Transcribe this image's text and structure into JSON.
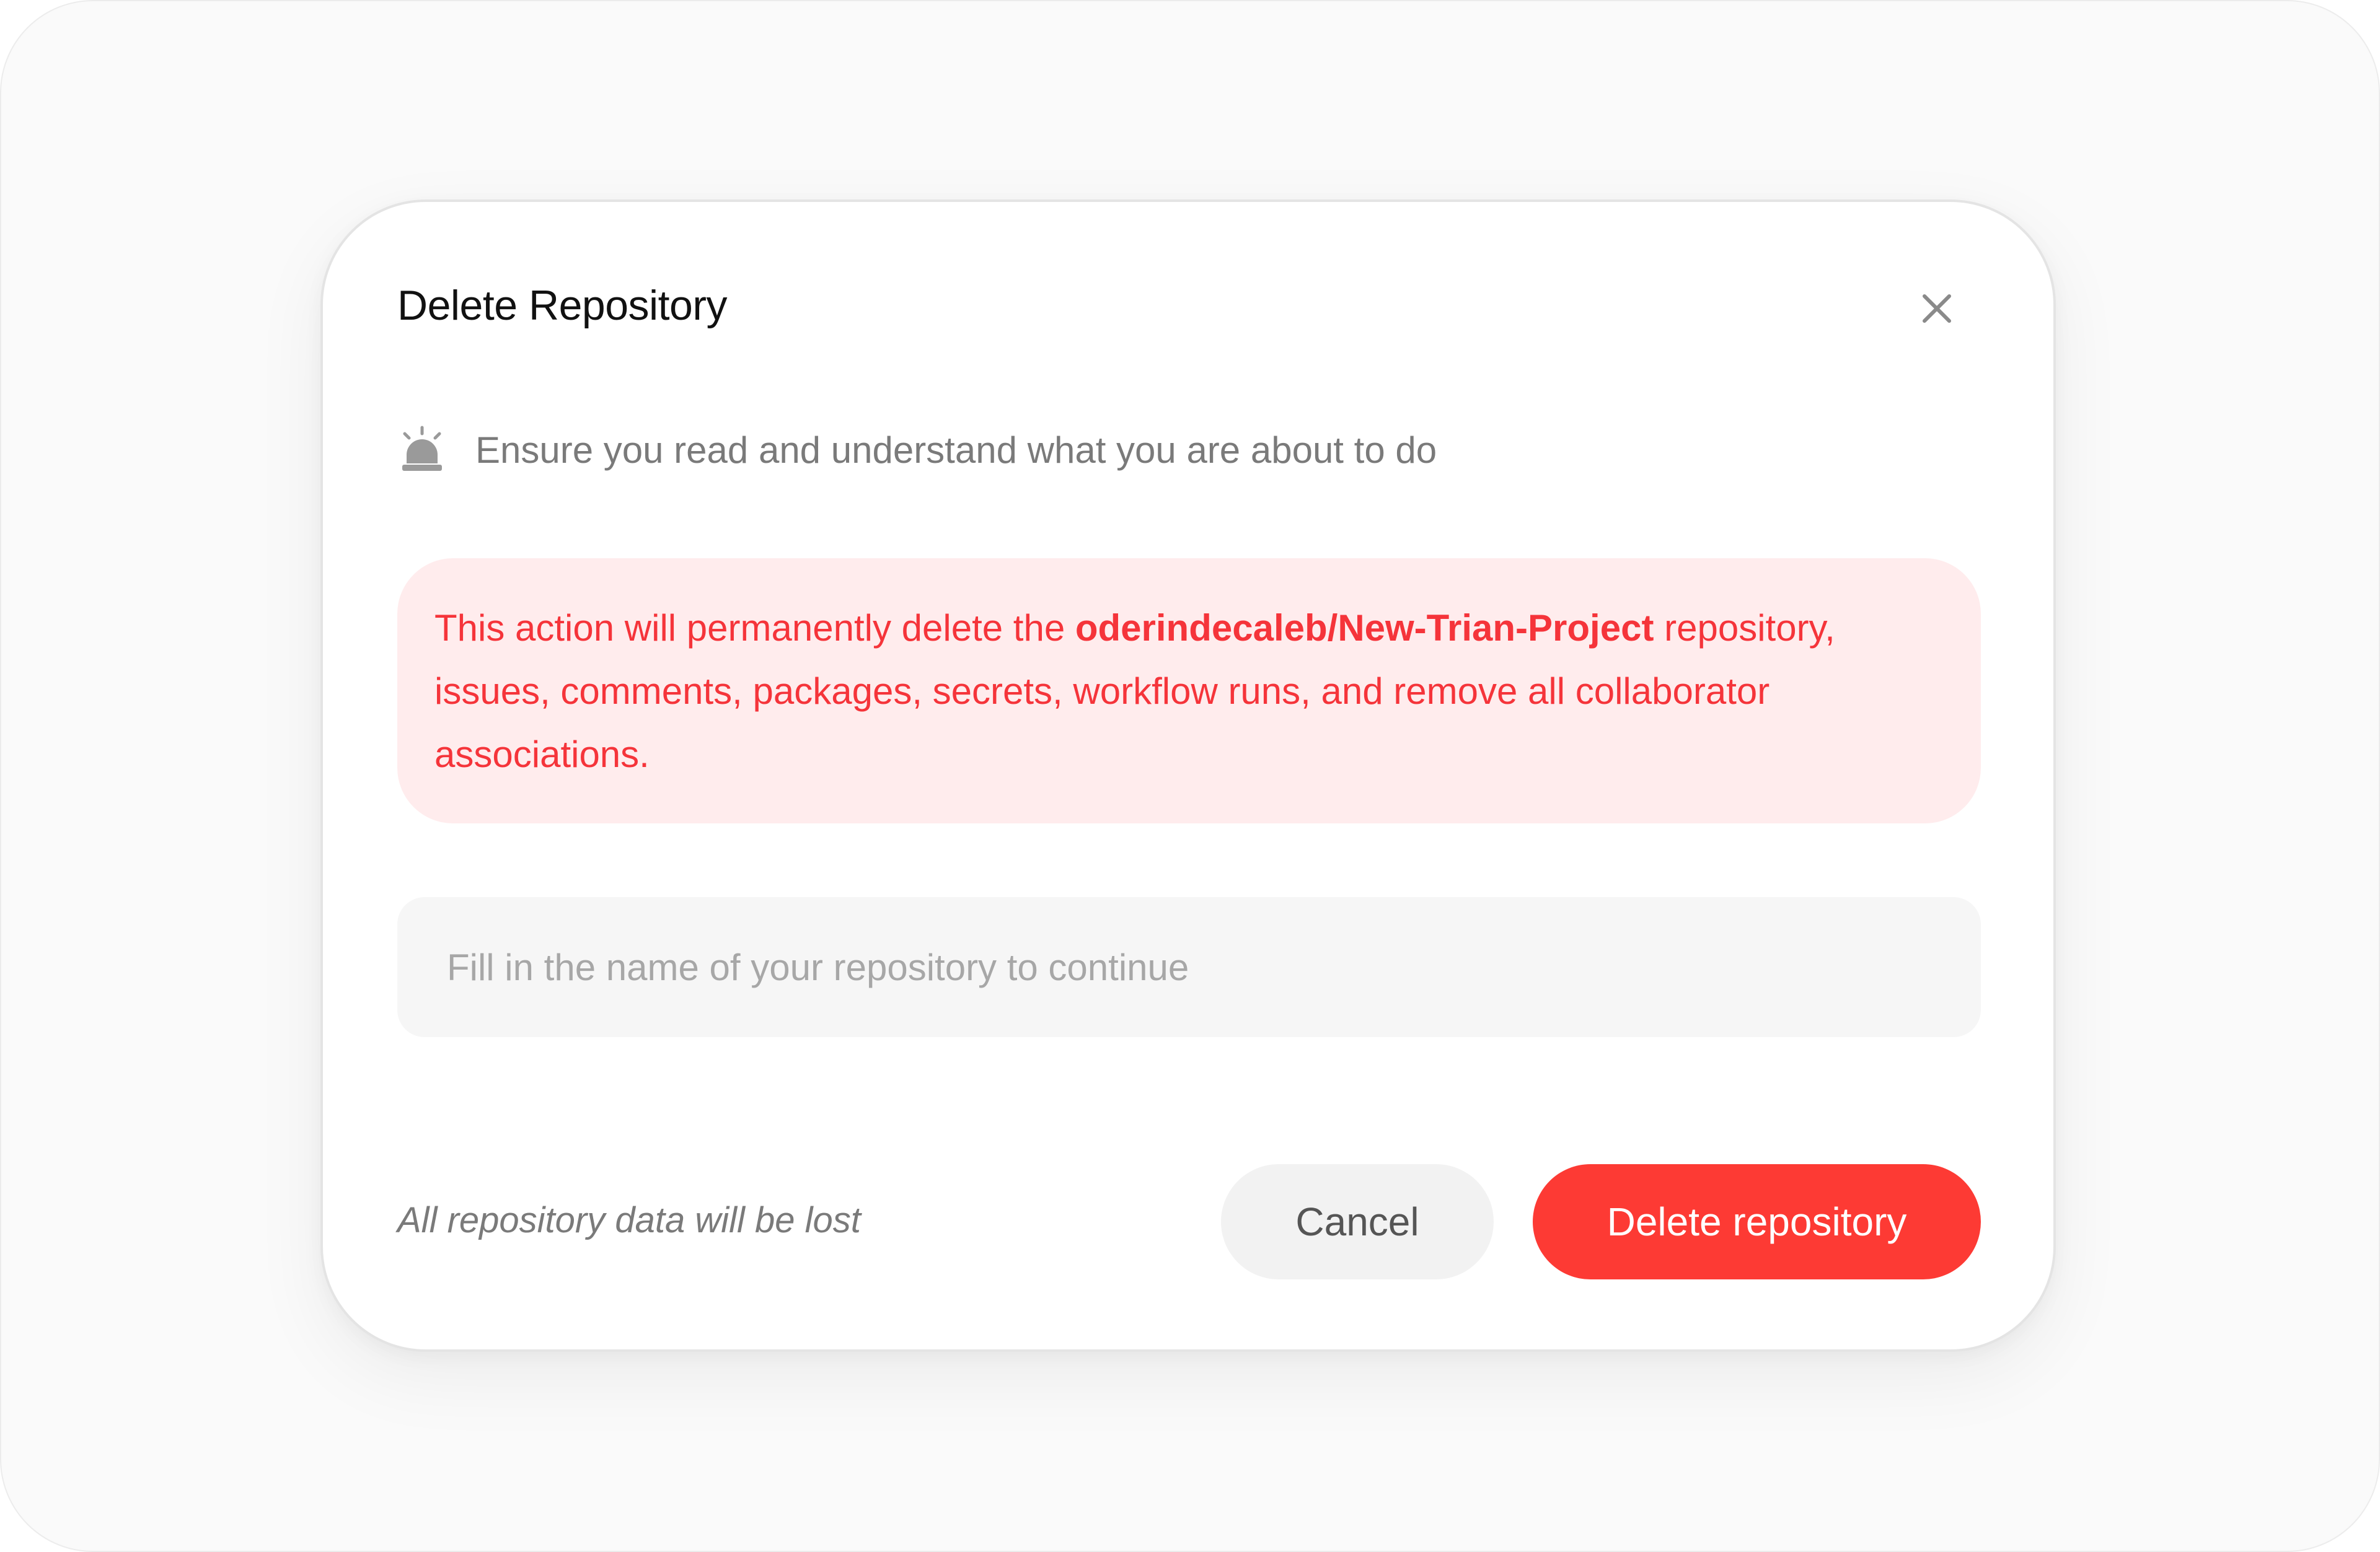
{
  "dialog": {
    "title": "Delete Repository",
    "close_icon": "close-icon",
    "notice": {
      "icon": "alarm-siren-icon",
      "text": "Ensure you read and understand what you are about to do"
    },
    "warning": {
      "prefix": "This action will permanently delete the ",
      "repo_name": "oderindecaleb/New-Trian-Project",
      "suffix": " repository, issues, comments, packages, secrets, workflow runs, and remove all collaborator associations."
    },
    "input": {
      "value": "",
      "placeholder": "Fill in the name of your repository to continue"
    },
    "footnote": "All repository data will be lost",
    "buttons": {
      "cancel_label": "Cancel",
      "delete_label": "Delete repository"
    }
  },
  "colors": {
    "danger": "#fd3a34",
    "danger_text": "#f5343a",
    "danger_bg": "#ffeced",
    "muted_text": "#7a7a7a",
    "input_bg": "#f6f6f6",
    "cancel_bg": "#f2f2f2"
  }
}
